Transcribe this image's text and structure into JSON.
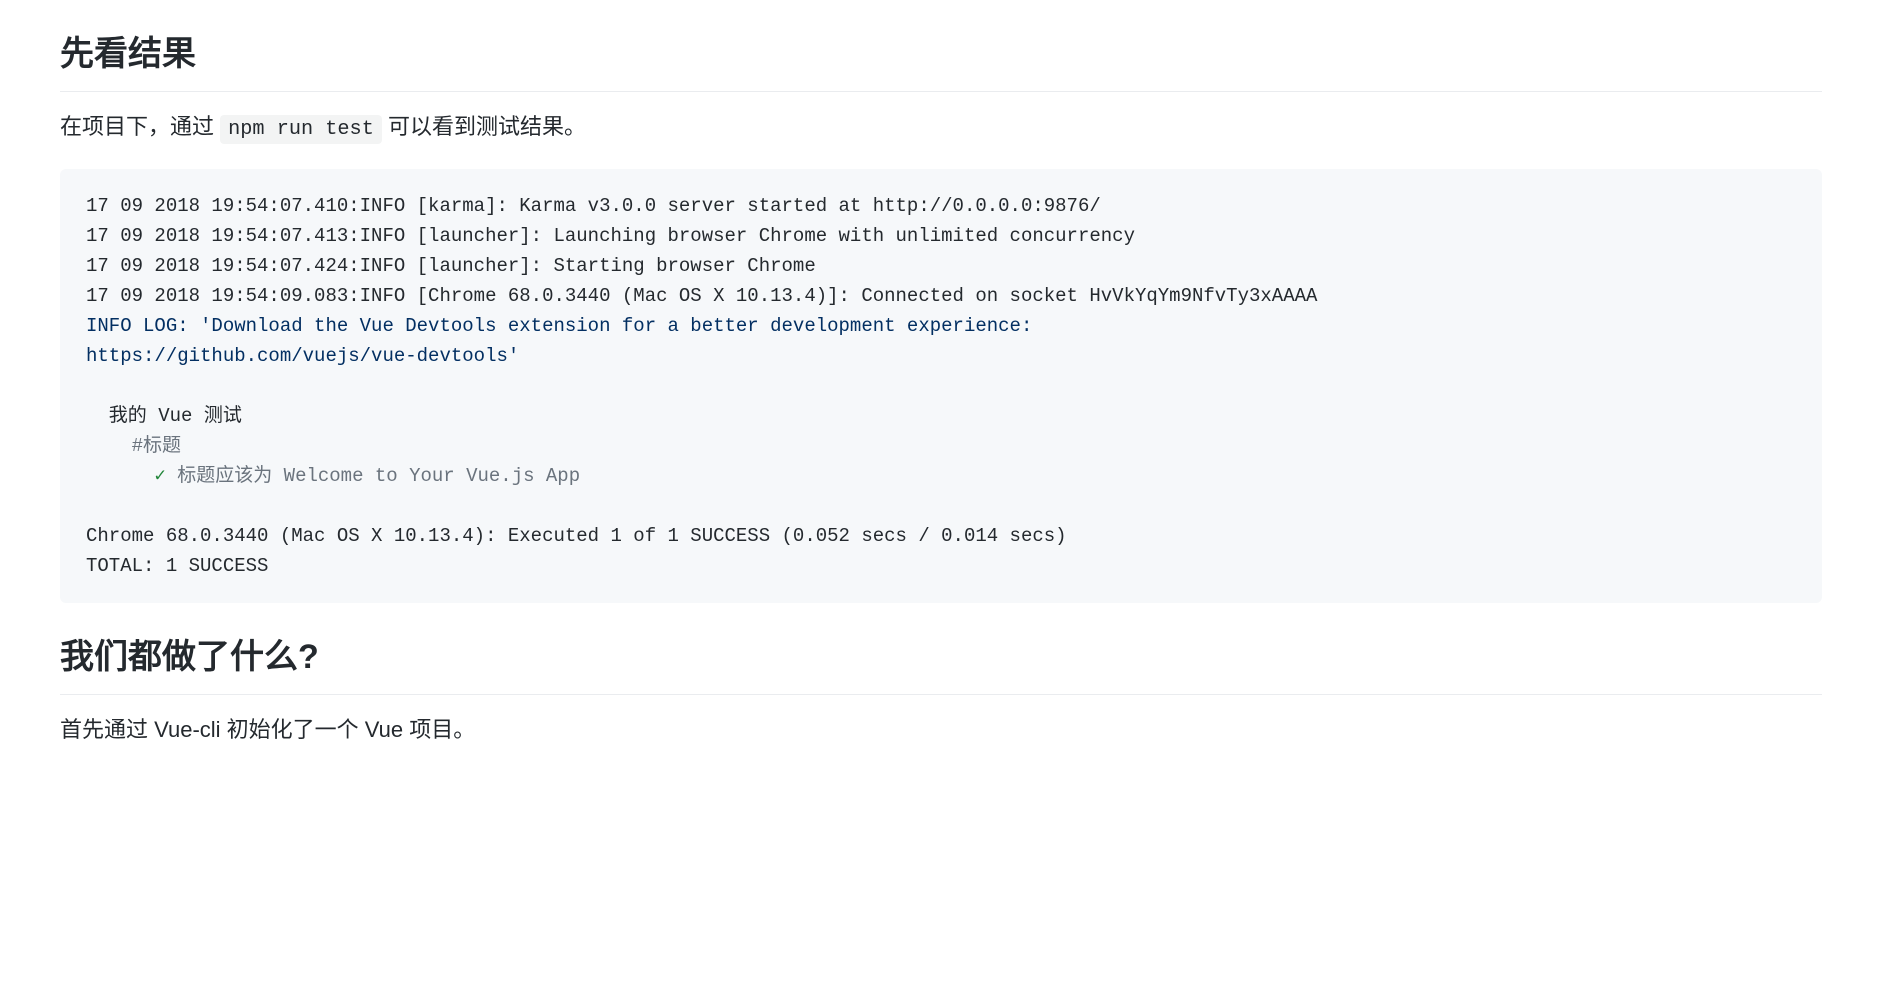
{
  "section1": {
    "heading": "先看结果",
    "para_before": "在项目下，通过 ",
    "inline_code": "npm run test",
    "para_after": " 可以看到测试结果。"
  },
  "code_block": {
    "l1": "17 09 2018 19:54:07.410:INFO [karma]: Karma v3.0.0 server started at http://0.0.0.0:9876/",
    "l2": "17 09 2018 19:54:07.413:INFO [launcher]: Launching browser Chrome with unlimited concurrency",
    "l3": "17 09 2018 19:54:07.424:INFO [launcher]: Starting browser Chrome",
    "l4": "17 09 2018 19:54:09.083:INFO [Chrome 68.0.3440 (Mac OS X 10.13.4)]: Connected on socket HvVkYqYm9NfvTy3xAAAA",
    "l5": "INFO LOG: 'Download the Vue Devtools extension for a better development experience:",
    "l6": "https://github.com/vuejs/vue-devtools'",
    "blank1": "",
    "suite": "  我的 Vue 测试",
    "desc": "    #标题",
    "check_mark": "      ✓ ",
    "check_text": "标题应该为 Welcome to Your Vue.js App",
    "blank2": "",
    "l7": "Chrome 68.0.3440 (Mac OS X 10.13.4): Executed 1 of 1 SUCCESS (0.052 secs / 0.014 secs)",
    "l8": "TOTAL: 1 SUCCESS"
  },
  "section2": {
    "heading": "我们都做了什么?",
    "paragraph": "首先通过 Vue-cli 初始化了一个 Vue 项目。"
  }
}
